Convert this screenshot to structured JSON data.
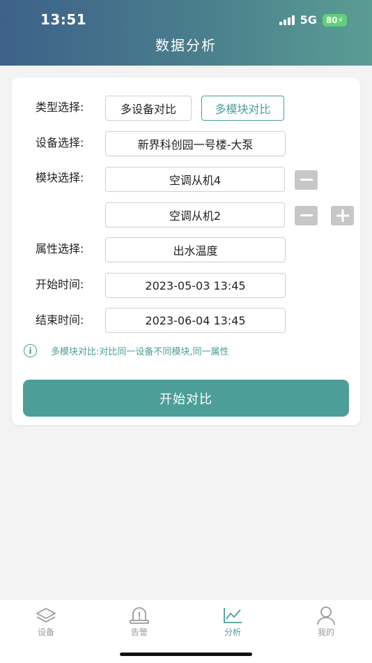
{
  "status_bar": {
    "time": "13:51",
    "network": "5G",
    "battery": "80"
  },
  "header": {
    "title": "数据分析"
  },
  "form": {
    "type_label": "类型选择:",
    "type_options": [
      "多设备对比",
      "多模块对比"
    ],
    "type_selected": "多模块对比",
    "device_label": "设备选择:",
    "device_value": "新界科创园一号楼-大泵",
    "module_label": "模块选择:",
    "modules": [
      "空调从机4",
      "空调从机2"
    ],
    "attribute_label": "属性选择:",
    "attribute_value": "出水温度",
    "start_label": "开始时间:",
    "start_value": "2023-05-03 13:45",
    "end_label": "结束时间:",
    "end_value": "2023-06-04 13:45",
    "hint": "多模块对比:对比同一设备不同模块,同一属性",
    "submit_label": "开始对比"
  },
  "tabbar": {
    "items": [
      {
        "label": "设备",
        "icon": "layers-icon"
      },
      {
        "label": "告警",
        "icon": "alarm-icon"
      },
      {
        "label": "分析",
        "icon": "chart-line-icon"
      },
      {
        "label": "我的",
        "icon": "user-icon"
      }
    ],
    "active": "分析",
    "accent_color": "#4a9e98"
  }
}
